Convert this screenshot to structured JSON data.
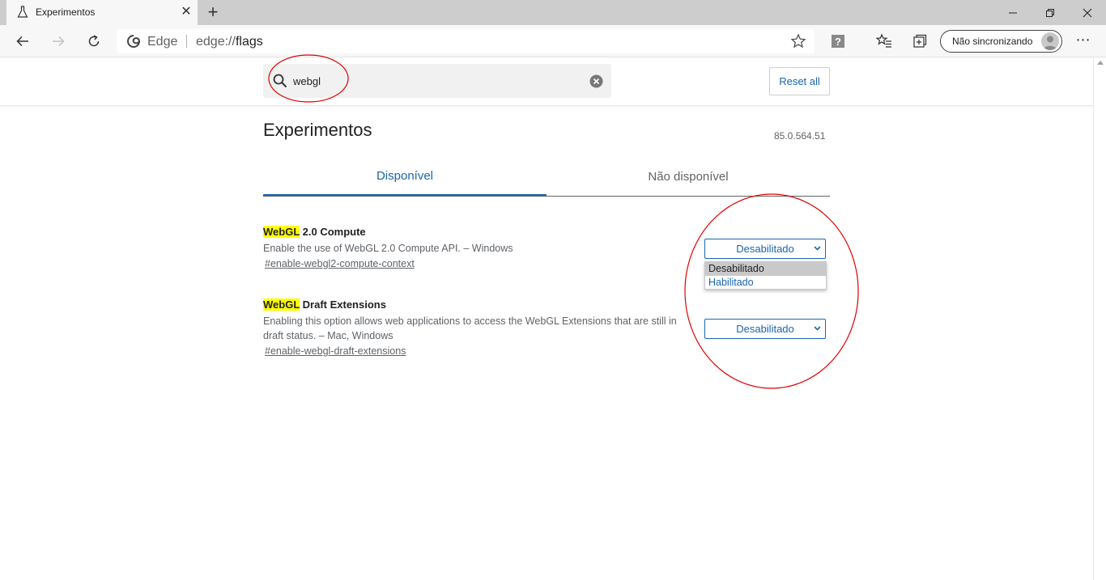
{
  "browser": {
    "tab_title": "Experimentos",
    "omnibox_label": "Edge",
    "url_scheme": "edge://",
    "url_host": "flags",
    "sync_label": "Não sincronizando"
  },
  "search": {
    "value": "webgl"
  },
  "reset_label": "Reset all",
  "page": {
    "title": "Experimentos",
    "version": "85.0.564.51",
    "tabs": [
      {
        "label": "Disponível",
        "active": true
      },
      {
        "label": "Não disponível",
        "active": false
      }
    ]
  },
  "experiments": [
    {
      "title_highlight": "WebGL",
      "title_rest": " 2.0 Compute",
      "description": "Enable the use of WebGL 2.0 Compute API. – Windows",
      "link": "#enable-webgl2-compute-context",
      "selected": "Desabilitado"
    },
    {
      "title_highlight": "WebGL",
      "title_rest": " Draft Extensions",
      "description": "Enabling this option allows web applications to access the WebGL Extensions that are still in draft status. – Mac, Windows",
      "link": "#enable-webgl-draft-extensions",
      "selected": "Desabilitado"
    }
  ],
  "dropdown_options": [
    "Desabilitado",
    "Habilitado"
  ],
  "colors": {
    "accent": "#1a65b0",
    "highlight": "#ffff00",
    "annotation": "#e00000"
  },
  "icons": [
    "flask-icon",
    "close-icon",
    "plus-icon",
    "minimize-icon",
    "restore-icon",
    "back-arrow-icon",
    "forward-arrow-icon",
    "refresh-icon",
    "edge-logo-icon",
    "star-icon",
    "help-icon",
    "favorites-icon",
    "collections-icon",
    "avatar-icon",
    "more-icon",
    "search-icon",
    "clear-icon",
    "chevron-down-icon"
  ]
}
